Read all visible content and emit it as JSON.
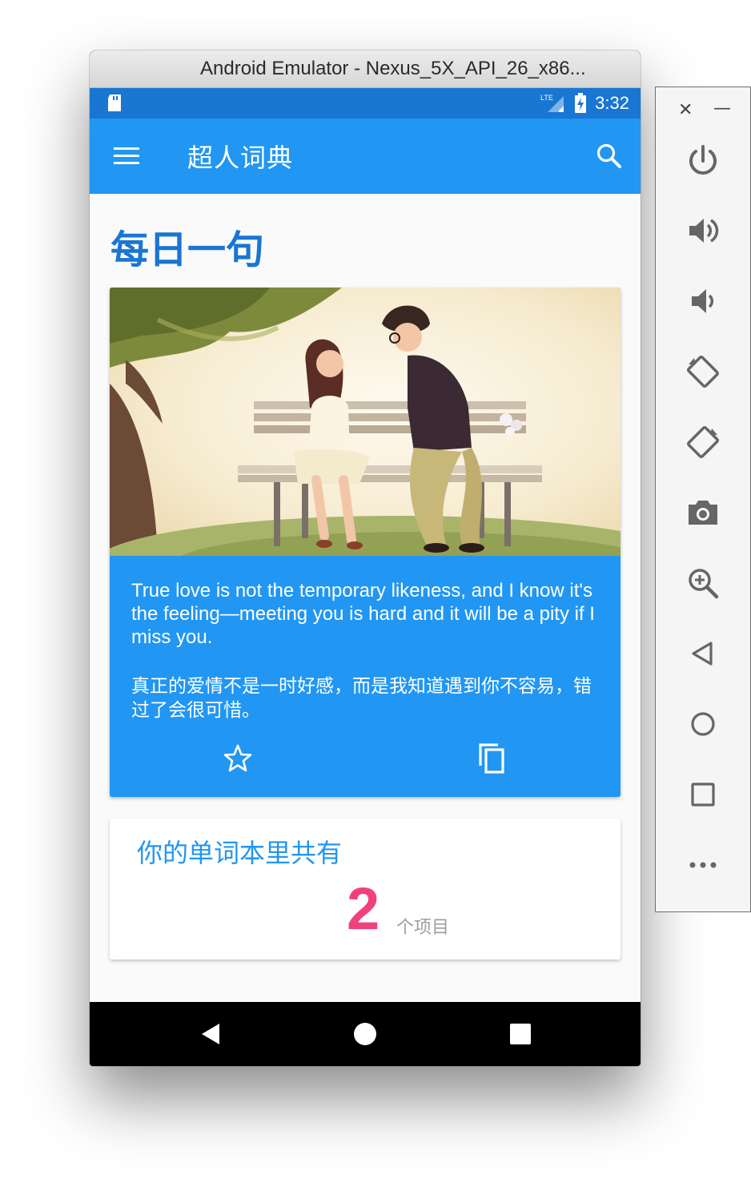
{
  "window": {
    "title": "Android Emulator - Nexus_5X_API_26_x86..."
  },
  "statusbar": {
    "network": "LTE",
    "time": "3:32"
  },
  "appbar": {
    "title": "超人词典"
  },
  "daily": {
    "heading": "每日一句",
    "quote_en": "True love is not the temporary likeness, and I know it's the feeling—meeting you is hard and it will be a pity if I miss you.",
    "quote_zh": "真正的爱情不是一时好感，而是我知道遇到你不容易，错过了会很可惜。"
  },
  "wordbook": {
    "title": "你的单词本里共有",
    "count": "2",
    "unit": "个项目"
  },
  "icons": {
    "menu": "menu-icon",
    "search": "search-icon",
    "star": "star-outline-icon",
    "copy": "copy-icon",
    "back": "back-icon",
    "home": "home-icon",
    "recents": "recents-icon"
  },
  "side_toolbar": {
    "close": "✕",
    "minimize": "—",
    "buttons": [
      "power",
      "volume-up",
      "volume-down",
      "rotate-left",
      "rotate-right",
      "camera",
      "zoom",
      "back",
      "home",
      "overview",
      "more"
    ]
  },
  "colors": {
    "primary": "#2196f3",
    "primary_dark": "#1976d2",
    "accent": "#f0427a"
  }
}
